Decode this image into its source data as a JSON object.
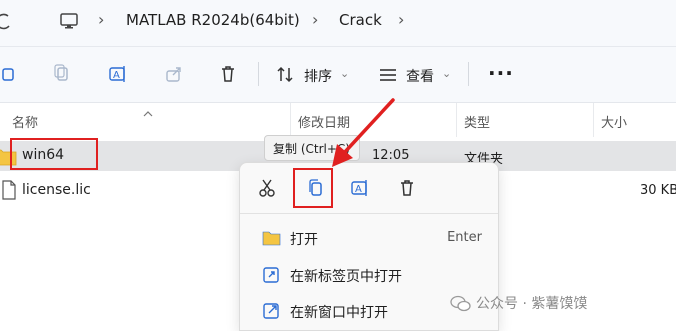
{
  "address_bar": {
    "nav_icon": "refresh-icon",
    "computer_icon": "computer-icon",
    "crumbs": [
      "MATLAB R2024b(64bit)",
      "Crack"
    ]
  },
  "toolbar": {
    "sort_label": "排序",
    "view_label": "查看",
    "more_label": "···"
  },
  "columns": {
    "name": "名称",
    "modified": "修改日期",
    "type": "类型",
    "size": "大小"
  },
  "files": [
    {
      "name": "win64",
      "modified": "12:05",
      "type": "文件夹",
      "size": ""
    },
    {
      "name": "license.lic",
      "modified": "",
      "type": "",
      "size": "30 KB"
    }
  ],
  "tooltip": {
    "text": "复制 (Ctrl+C)"
  },
  "context_menu": {
    "items": [
      {
        "label": "打开",
        "shortcut": "Enter"
      },
      {
        "label": "在新标签页中打开",
        "shortcut": ""
      },
      {
        "label": "在新窗口中打开",
        "shortcut": ""
      }
    ]
  },
  "watermark": {
    "text": "公众号 · 紫薯馍馍"
  },
  "colors": {
    "annotation_red": "#e02020",
    "folder_yellow": "#f4c542",
    "accent_blue": "#2b6cd4"
  }
}
